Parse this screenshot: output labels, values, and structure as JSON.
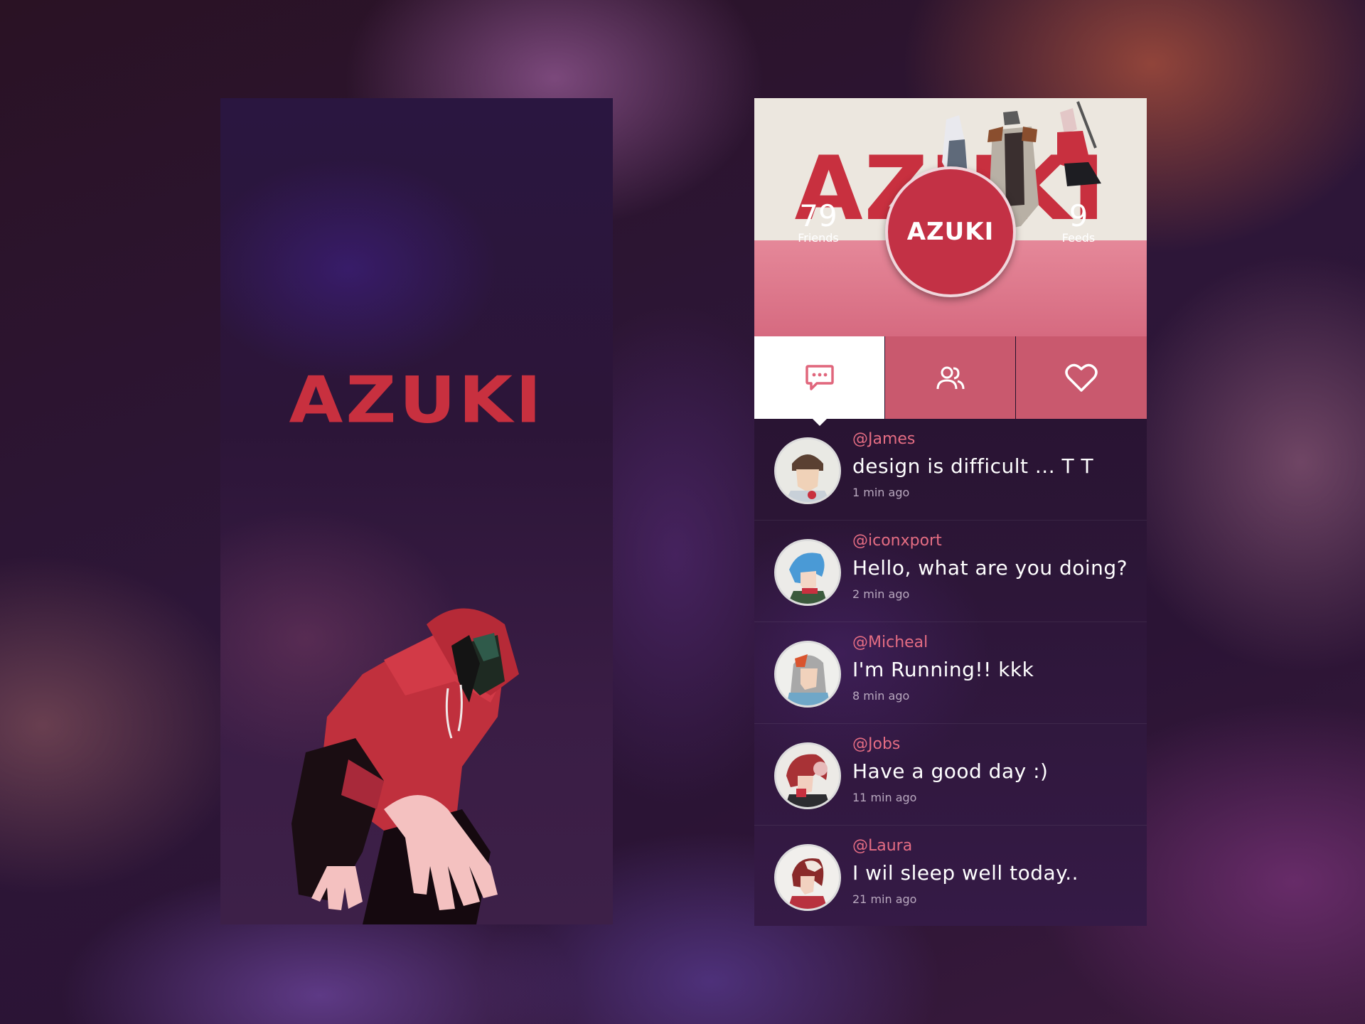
{
  "splash": {
    "logo_text": "AZUKI",
    "illustration": "red-hoodie-character"
  },
  "profile": {
    "banner_text": "AZUKI",
    "badge_text": "AZUKI",
    "stats": {
      "friends_count": "79",
      "friends_label": "Friends",
      "feeds_count": "9",
      "feeds_label": "Feeds"
    },
    "tabs": [
      {
        "icon": "chat-bubble-icon",
        "active": true
      },
      {
        "icon": "users-icon",
        "active": false
      },
      {
        "icon": "heart-icon",
        "active": false
      }
    ],
    "feed": [
      {
        "handle": "@James",
        "message": "design is difficult ... T T",
        "time": "1 min ago"
      },
      {
        "handle": "@iconxport",
        "message": "Hello, what are you doing?",
        "time": "2 min ago"
      },
      {
        "handle": "@Micheal",
        "message": "I'm Running!! kkk",
        "time": "8 min ago"
      },
      {
        "handle": "@Jobs",
        "message": "Have a good day :)",
        "time": "11 min ago"
      },
      {
        "handle": "@Laura",
        "message": "I wil sleep well today..",
        "time": "21 min ago"
      }
    ]
  },
  "colors": {
    "brand_red": "#c8303f",
    "tab_pink": "#c9596e",
    "handle_pink": "#e56d83"
  }
}
